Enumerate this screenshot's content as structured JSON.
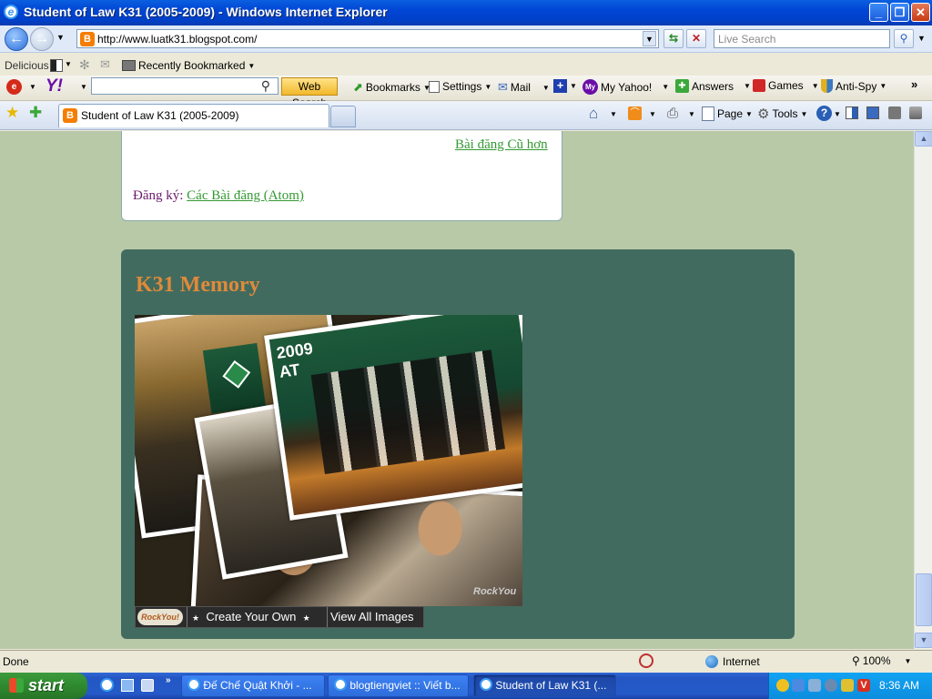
{
  "window": {
    "title": "Student of Law K31 (2005-2009) - Windows Internet Explorer",
    "minimize": "_",
    "restore": "❐",
    "close": "✕"
  },
  "address_bar": {
    "url": "http://www.luatk31.blogspot.com/"
  },
  "search": {
    "placeholder": "Live Search"
  },
  "delicious_bar": {
    "label": "Delicious",
    "recently_bookmarked": "Recently Bookmarked"
  },
  "yahoo_bar": {
    "web_search": "Web Search",
    "bookmarks": "Bookmarks",
    "settings": "Settings",
    "mail": "Mail",
    "my_yahoo": "My Yahoo!",
    "answers": "Answers",
    "games": "Games",
    "anti_spy": "Anti-Spy",
    "more": "»"
  },
  "tabs": [
    {
      "label": "Student of Law K31 (2005-2009)"
    }
  ],
  "command_bar": {
    "page": "Page",
    "tools": "Tools"
  },
  "page": {
    "older_posts_link": "Bài đăng Cũ hơn",
    "subscribe_label": "Đăng ký:",
    "subscribe_link": "Các Bài đăng (Atom)",
    "memory_title": "K31 Memory",
    "slideshow": {
      "banner_year": "2009",
      "banner_text": "AT",
      "watermark": "RockYou",
      "logo_text": "RockYou!",
      "create_own": "Create Your Own",
      "view_all": "View All Images"
    }
  },
  "status_bar": {
    "status": "Done",
    "zone": "Internet",
    "zoom": "100%"
  },
  "taskbar": {
    "start": "start",
    "tasks": [
      {
        "label": "Đế Chế Quật Khởi - ..."
      },
      {
        "label": "blogtiengviet :: Viết b..."
      },
      {
        "label": "Student of Law K31 (..."
      }
    ],
    "clock": "8:36 AM"
  },
  "colors": {
    "page_bg": "#b8c9a8",
    "memory_bg": "#426b5f",
    "memory_title": "#e08a3a",
    "link": "#339933"
  }
}
